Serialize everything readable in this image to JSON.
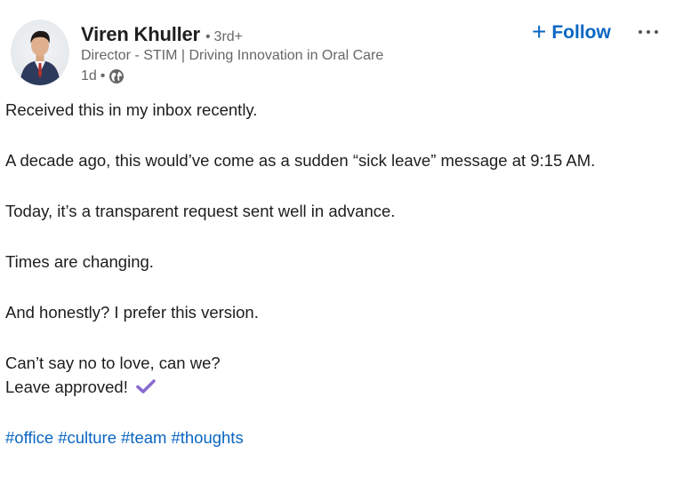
{
  "author": {
    "name": "Viren Khuller",
    "degree": "3rd+",
    "headline": "Director - STIM | Driving Innovation in Oral Care",
    "posted_ago": "1d",
    "visibility_icon": "globe-icon"
  },
  "actions": {
    "follow_label": "Follow",
    "follow_icon": "plus-icon",
    "more_icon": "more-options-icon"
  },
  "post": {
    "line1": "Received this in my inbox recently.",
    "line2": "A decade ago, this would’ve come as a sudden “sick leave” message at 9:15 AM.",
    "line3": "Today, it’s a transparent request sent well in advance.",
    "line4": "Times are changing.",
    "line5": "And honestly? I prefer this version.",
    "line6": "Can’t say no to love, can we?",
    "line7": "Leave approved!",
    "hashtags": [
      "#office",
      "#culture",
      "#team",
      "#thoughts"
    ]
  },
  "colors": {
    "link": "#0a66c2",
    "check": "#8a6bd1",
    "text": "#1d1d1d",
    "muted": "#666666"
  }
}
